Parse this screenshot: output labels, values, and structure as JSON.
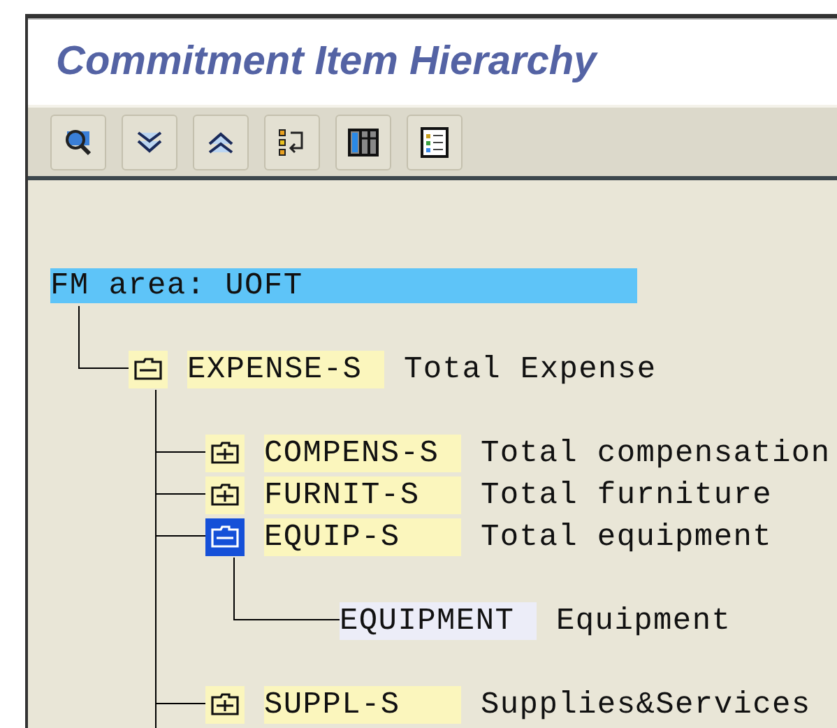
{
  "title": "Commitment Item Hierarchy",
  "tree": {
    "label": "FM area: UOFT",
    "selected": true,
    "children": [
      {
        "kind": "folder",
        "code": "EXPENSE-S",
        "description": "Total Expense",
        "expanded": true,
        "selected": false,
        "continues": true,
        "children": [
          {
            "kind": "folder",
            "code": "COMPENS-S",
            "description": "Total compensation",
            "expanded": false,
            "selected": false
          },
          {
            "kind": "folder",
            "code": "FURNIT-S",
            "description": "Total furniture",
            "expanded": false,
            "selected": false
          },
          {
            "kind": "folder",
            "code": "EQUIP-S",
            "description": "Total equipment",
            "expanded": true,
            "selected": true,
            "children": [
              {
                "kind": "leaf",
                "code": "EQUIPMENT",
                "description": "Equipment",
                "selected": false
              }
            ]
          },
          {
            "kind": "folder",
            "code": "SUPPL-S",
            "description": "Supplies&Services",
            "expanded": false,
            "selected": false
          }
        ]
      }
    ]
  }
}
